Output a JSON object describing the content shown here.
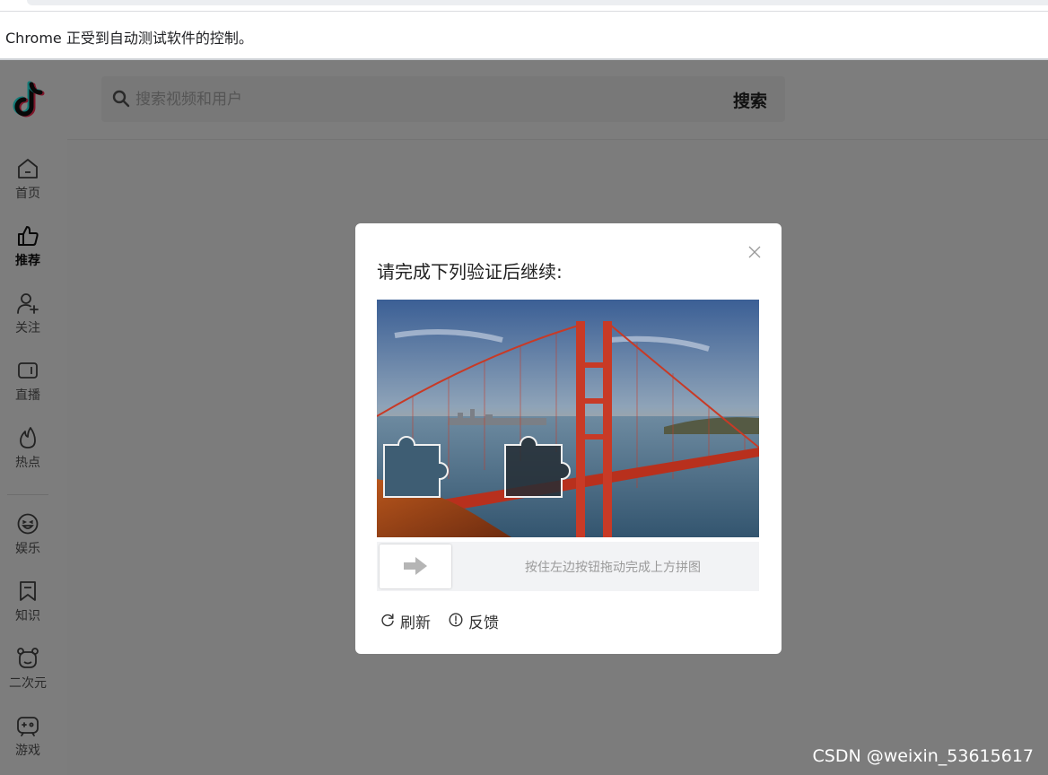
{
  "browser": {
    "automation_notice": "Chrome 正受到自动测试软件的控制。"
  },
  "sidebar": {
    "items": [
      {
        "label": "首页",
        "icon": "home-icon"
      },
      {
        "label": "推荐",
        "icon": "thumbs-up-icon",
        "active": true
      },
      {
        "label": "关注",
        "icon": "user-plus-icon"
      },
      {
        "label": "直播",
        "icon": "live-tv-icon"
      },
      {
        "label": "热点",
        "icon": "flame-icon"
      },
      {
        "label": "娱乐",
        "icon": "smile-icon"
      },
      {
        "label": "知识",
        "icon": "bookmark-icon"
      },
      {
        "label": "二次元",
        "icon": "anime-bear-icon"
      },
      {
        "label": "游戏",
        "icon": "gamepad-icon"
      }
    ]
  },
  "search": {
    "placeholder": "搜索视频和用户",
    "button_label": "搜索"
  },
  "captcha": {
    "title": "请完成下列验证后继续:",
    "slider_hint": "按住左边按钮拖动完成上方拼图",
    "refresh_label": "刷新",
    "feedback_label": "反馈"
  },
  "watermark": "CSDN @weixin_53615617",
  "colors": {
    "overlay": "rgba(0,0,0,0.5)",
    "bridge": "#c83a26",
    "sky_top": "#3b5f95",
    "sky_horizon": "#f0b25a",
    "water": "#4a6a82"
  }
}
